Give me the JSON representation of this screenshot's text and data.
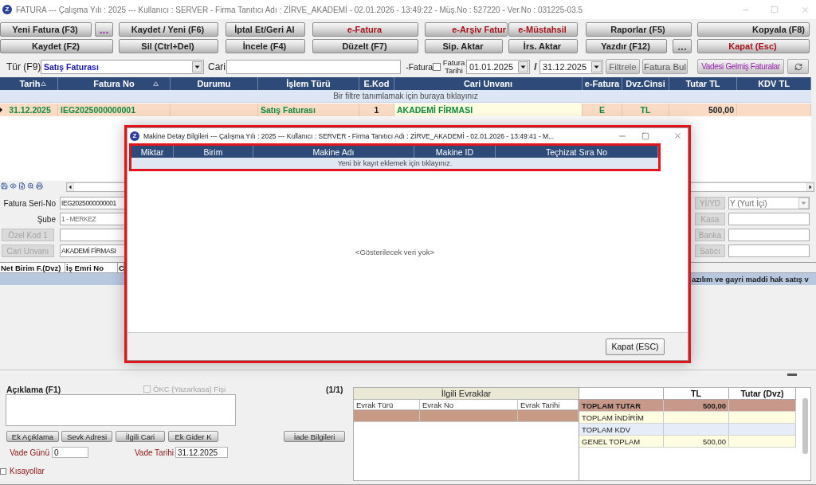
{
  "window": {
    "logo": "Z",
    "title": "FATURA --- Çalışma Yılı : 2025 --- Kullanıcı : SERVER - Firma Tanıtıcı Adı : ZİRVE_AKADEMİ - 02.01.2026 - 13:49:22 - Müş.No : 527220 - Ver.No : 031225-03.5"
  },
  "toolbar": [
    [
      {
        "label": "Yeni Fatura (F3)",
        "color": "#222222"
      },
      {
        "label": "...",
        "color": "#9b2fae"
      },
      {
        "label": "Kaydet / Yeni (F6)",
        "color": "#222222"
      },
      {
        "label": "İptal Et/Geri Al",
        "color": "#222222"
      },
      {
        "label": "e-Fatura",
        "color": "#a6121a"
      },
      {
        "label": "e-Arşiv Fatur",
        "color": "#a6121a"
      },
      {
        "label": "e-Müstahsil",
        "color": "#a6121a"
      },
      {
        "label": "Raporlar (F5)",
        "color": "#222222"
      },
      {
        "label": "Kopyala (F8)",
        "color": "#222222"
      }
    ],
    [
      {
        "label": "Kaydet (F2)",
        "color": "#222222"
      },
      {
        "label": "Sil (Ctrl+Del)",
        "color": "#222222"
      },
      {
        "label": "İncele (F4)",
        "color": "#222222"
      },
      {
        "label": "Düzelt (F7)",
        "color": "#222222"
      },
      {
        "label": "Sip. Aktar",
        "color": "#222222"
      },
      {
        "label": "İrs. Aktar",
        "color": "#222222"
      },
      {
        "label": "Yazdır (F12)",
        "color": "#222222"
      },
      {
        "label": "...",
        "color": "#555555"
      },
      {
        "label": "Kapat (Esc)",
        "color": "#a6121a"
      }
    ]
  ],
  "filter": {
    "type": {
      "label": "Tür (F9)",
      "value": "Satış Faturası"
    },
    "cari": {
      "label": "Cari"
    },
    "e_invoice_label": "-Fatura",
    "date_filter": {
      "checked": false,
      "label": "Fatura Tarihi"
    },
    "date_from": "01.01.2025",
    "separator": "/",
    "date_to": "31.12.2025",
    "buttons": [
      {
        "label": "Filtrele",
        "color": "#666666"
      },
      {
        "label": "Fatura Bul",
        "color": "#555555"
      },
      {
        "label": "Vadesi Gelmiş Faturalar",
        "color": "#9a22ae"
      }
    ]
  },
  "invoices": {
    "columns": [
      {
        "label": "Tarih",
        "sorted": true
      },
      {
        "label": "Fatura No",
        "sorted": true
      },
      {
        "label": "Durumu",
        "sorted": false
      },
      {
        "label": "İşlem Türü",
        "sorted": false
      },
      {
        "label": "E.Kod",
        "sorted": false
      },
      {
        "label": "Cari Unvanı",
        "sorted": false
      },
      {
        "label": "e-Fatura",
        "sorted": false
      },
      {
        "label": "Dvz.Cinsi",
        "sorted": false
      },
      {
        "label": "Tutar TL",
        "sorted": false
      },
      {
        "label": "KDV TL",
        "sorted": false
      }
    ],
    "filter_hint": "Bir filtre tanımlamak için buraya tıklayınız",
    "rows": [
      {
        "selected": true,
        "cells": [
          {
            "text": "31.12.2025",
            "focused": false
          },
          {
            "text": "IEG2025000000001",
            "focused": false
          },
          {
            "focused": false
          },
          {
            "text": "Satış Faturası",
            "focused": false
          },
          {
            "text": "1",
            "focused": false
          },
          {
            "text": "AKADEMİ FİRMASI",
            "focused": true
          },
          {
            "text": "E",
            "focused": false
          },
          {
            "text": "TL",
            "focused": false
          },
          {
            "text": "500,00",
            "focused": false
          },
          {
            "focused": false
          }
        ]
      }
    ]
  },
  "details": {
    "left": [
      {
        "kind": "label",
        "label": "Fatura Seri-No",
        "value": "IEG2025000000001",
        "disabled": false
      },
      {
        "kind": "label",
        "label": "Şube",
        "value": "1 - MERKEZ",
        "disabled": true
      },
      {
        "kind": "button",
        "label": "Özel Kod 1",
        "disabled": true
      },
      {
        "kind": "button",
        "label": "Cari Unvanı",
        "value": "AKADEMİ FİRMASI",
        "disabled": true
      }
    ],
    "right": [
      {
        "kind": "dropdown",
        "label": "Yİ/YD",
        "value": "Y (Yurt İçi)",
        "disabled": true
      },
      {
        "kind": "input",
        "label": "Kasa",
        "disabled": true
      },
      {
        "kind": "input",
        "label": "Banka",
        "disabled": true
      },
      {
        "kind": "input",
        "label": "Satıcı",
        "disabled": true
      }
    ]
  },
  "lines": {
    "columns": [
      "Net Birim F.(Dvz)",
      "İş Emri No",
      "C"
    ],
    "band_text": "azılım ve gayri maddi hak satış v"
  },
  "dialog": {
    "logo": "Z",
    "title": "Makine Detay Bilgileri --- Çalışma Yılı : 2025 --- Kullanıcı : SERVER - Firma Tanıtıcı Adı : ZİRVE_AKADEMİ - 02.01.2026 - 13:49:41 - M...",
    "highlighted": true,
    "header_highlighted": true,
    "columns": [
      "Miktar",
      "Birim",
      "Makine Adı",
      "Makine ID",
      "Teçhizat Sıra No"
    ],
    "new_row_hint": "Yeni bir kayıt eklemek için tıklayınız.",
    "empty_text": "<Gösterilecek veri yok>",
    "close_button": "Kapat (ESC)"
  },
  "notes": {
    "label": "Açıklama (F1)",
    "okc": {
      "label": "ÖKC (Yazarkasa) Fişi",
      "checked": false,
      "disabled": true
    },
    "page": "(1/1)",
    "buttons": [
      "Ek Açıklama",
      "Sevk Adresi",
      "İlgili Cari",
      "Ek Gider K"
    ],
    "return_button": "İade Bilgileri",
    "due_days": {
      "label": "Vade Günü",
      "value": "0"
    },
    "due_date": {
      "label": "Vade Tarihi",
      "value": "31.12.2025"
    },
    "shortcuts": {
      "label": "Kısayollar",
      "checked": false
    }
  },
  "related_docs": {
    "title": "İlgili Evraklar",
    "columns": [
      "Evrak Türü",
      "Evrak No",
      "Evrak Tarihi"
    ],
    "rows": [
      {
        "selected": true
      }
    ]
  },
  "totals": {
    "columns": [
      "TL",
      "Tutar (Dvz)"
    ],
    "rows": [
      {
        "label": "TOPLAM TUTAR",
        "tl": "500,00",
        "selected": true
      },
      {
        "label": "TOPLAM İNDİRİM",
        "selected": false
      },
      {
        "label": "TOPLAM KDV",
        "selected": false
      },
      {
        "label": "GENEL TOPLAM",
        "tl": "500,00",
        "selected": false
      }
    ]
  }
}
